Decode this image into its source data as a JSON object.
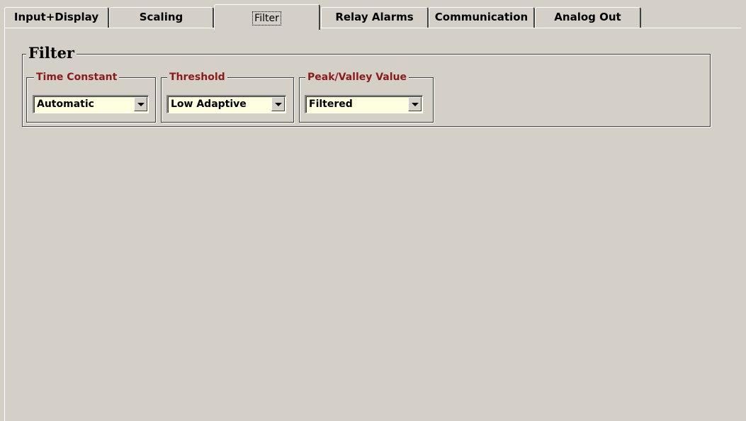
{
  "tabs": [
    {
      "label": "Input+Display",
      "active": false
    },
    {
      "label": "Scaling",
      "active": false
    },
    {
      "label": "Filter",
      "active": true
    },
    {
      "label": "Relay Alarms",
      "active": false
    },
    {
      "label": "Communication",
      "active": false
    },
    {
      "label": "Analog Out",
      "active": false
    }
  ],
  "filter_group": {
    "title": "Filter",
    "time_constant": {
      "label": "Time Constant",
      "value": "Automatic"
    },
    "threshold": {
      "label": "Threshold",
      "value": "Low Adaptive"
    },
    "peak_valley": {
      "label": "Peak/Valley Value",
      "value": "Filtered"
    }
  },
  "colors": {
    "background": "#d4d0c8",
    "subgroup_label": "#8b1a1a",
    "combo_background": "#ffffe0"
  }
}
